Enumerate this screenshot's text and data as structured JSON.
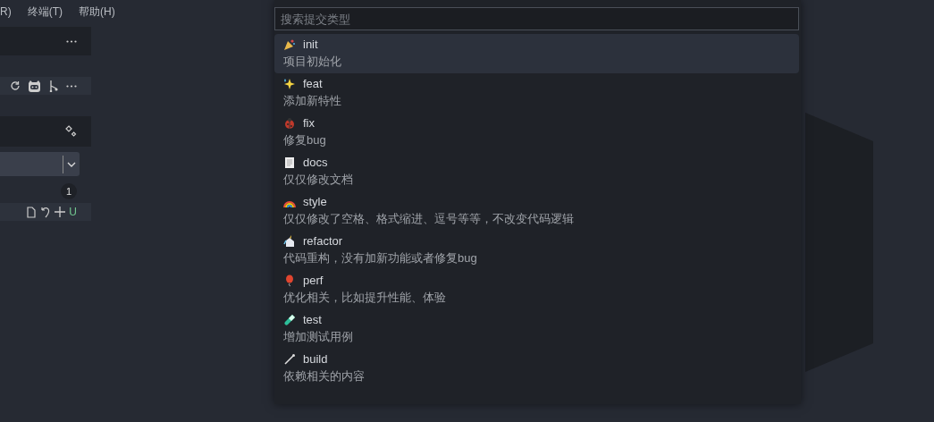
{
  "menu": [
    "R)",
    "终端(T)",
    "帮助(H)"
  ],
  "sidebar": {
    "badge": "1",
    "file_status": "U"
  },
  "quick_pick": {
    "placeholder": "搜索提交类型",
    "items": [
      {
        "label": "init",
        "description": "项目初始化",
        "selected": true
      },
      {
        "label": "feat",
        "description": "添加新特性",
        "selected": false
      },
      {
        "label": "fix",
        "description": "修复bug",
        "selected": false
      },
      {
        "label": "docs",
        "description": "仅仅修改文档",
        "selected": false
      },
      {
        "label": "style",
        "description": "仅仅修改了空格、格式缩进、逗号等等，不改变代码逻辑",
        "selected": false
      },
      {
        "label": "refactor",
        "description": "代码重构，没有加新功能或者修复bug",
        "selected": false
      },
      {
        "label": "perf",
        "description": "优化相关，比如提升性能、体验",
        "selected": false
      },
      {
        "label": "test",
        "description": "增加测试用例",
        "selected": false
      },
      {
        "label": "build",
        "description": "依赖相关的内容",
        "selected": false
      }
    ]
  }
}
